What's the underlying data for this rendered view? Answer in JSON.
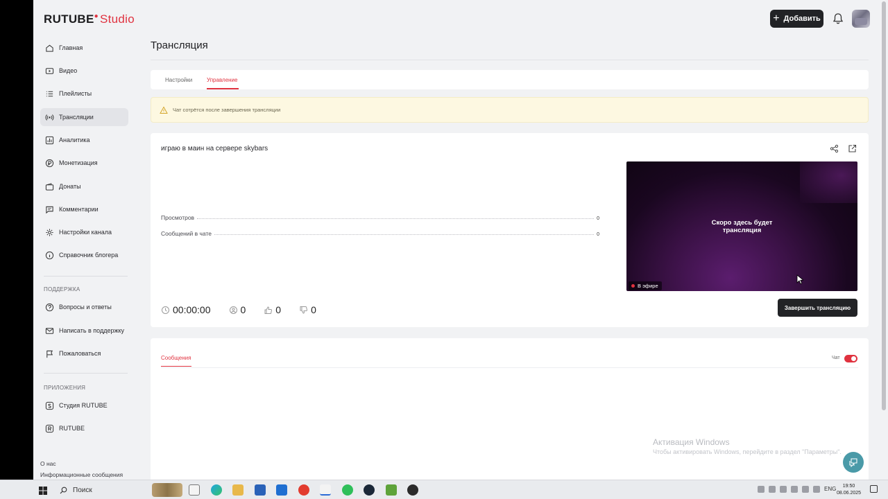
{
  "app": {
    "logo_main": "RUTUBE",
    "logo_sub": "Studio",
    "add_button": "Добавить"
  },
  "sidebar": {
    "items": [
      {
        "label": "Главная",
        "icon": "home-icon"
      },
      {
        "label": "Видео",
        "icon": "video-icon"
      },
      {
        "label": "Плейлисты",
        "icon": "playlist-icon"
      },
      {
        "label": "Трансляции",
        "icon": "broadcast-icon",
        "active": true
      },
      {
        "label": "Аналитика",
        "icon": "analytics-icon"
      },
      {
        "label": "Монетизация",
        "icon": "ruble-icon"
      },
      {
        "label": "Донаты",
        "icon": "wallet-icon"
      },
      {
        "label": "Комментарии",
        "icon": "comment-icon"
      },
      {
        "label": "Настройки канала",
        "icon": "gear-icon"
      },
      {
        "label": "Справочник блогера",
        "icon": "info-icon"
      }
    ],
    "support_title": "ПОДДЕРЖКА",
    "support_items": [
      {
        "label": "Вопросы и ответы",
        "icon": "question-icon"
      },
      {
        "label": "Написать в поддержку",
        "icon": "mail-icon"
      },
      {
        "label": "Пожаловаться",
        "icon": "flag-icon"
      }
    ],
    "apps_title": "ПРИЛОЖЕНИЯ",
    "apps_items": [
      {
        "label": "Студия RUTUBE",
        "icon": "studio-app-icon"
      },
      {
        "label": "RUTUBE",
        "icon": "rutube-app-icon"
      }
    ],
    "footer": [
      "О нас",
      "Информационные сообщения"
    ]
  },
  "main": {
    "page_title": "Трансляция",
    "tabs": [
      {
        "label": "Настройки",
        "active": false
      },
      {
        "label": "Управление",
        "active": true
      }
    ],
    "warning": "Чат сотрётся после завершения трансляции",
    "stream": {
      "title": "играю в маин на сервере skybars",
      "stats": [
        {
          "label": "Просмотров",
          "value": "0"
        },
        {
          "label": "Сообщений в чате",
          "value": "0"
        }
      ],
      "timer": "00:00:00",
      "viewers": "0",
      "likes": "0",
      "dislikes": "0",
      "player_text_line1": "Скоро здесь будет",
      "player_text_line2": "трансляция",
      "live_badge": "В эфире",
      "end_button": "Завершить трансляцию"
    },
    "chat": {
      "tab": "Сообщения",
      "toggle_label": "Чат",
      "toggle_on": true
    }
  },
  "watermark": {
    "line1": "Активация Windows",
    "line2": "Чтобы активировать Windows, перейдите в раздел \"Параметры\"."
  },
  "taskbar": {
    "search_placeholder": "Поиск",
    "lang": "ENG",
    "time": "19:50",
    "date": "08.06.2025"
  },
  "colors": {
    "accent": "#e0323f",
    "dark_button": "#222326",
    "page_bg": "#f1f2f4"
  }
}
